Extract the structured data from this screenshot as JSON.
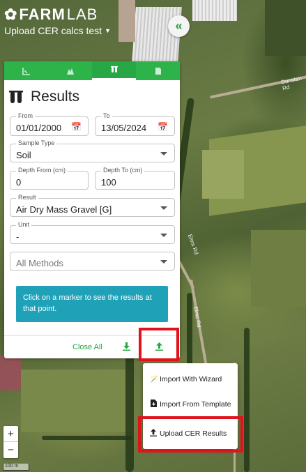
{
  "app": {
    "logo_bold": "FARM",
    "logo_thin": "LAB",
    "project_name": "Upload CER calcs test",
    "collapse_icon": "double-chevron-left-icon"
  },
  "tabs": [
    {
      "name": "chart-tab",
      "icon": "ruler-icon",
      "active": false
    },
    {
      "name": "map-tab",
      "icon": "map-pin-icon",
      "active": false
    },
    {
      "name": "results-tab",
      "icon": "test-tubes-icon",
      "active": true
    },
    {
      "name": "document-tab",
      "icon": "document-icon",
      "active": false
    }
  ],
  "panel": {
    "title": "Results",
    "from_label": "From",
    "from_value": "01/01/2000",
    "to_label": "To",
    "to_value": "13/05/2024",
    "sample_type_label": "Sample Type",
    "sample_type_value": "Soil",
    "depth_from_label": "Depth From (cm)",
    "depth_from_value": "0",
    "depth_to_label": "Depth To (cm)",
    "depth_to_value": "100",
    "result_label": "Result",
    "result_value": "Air Dry Mass Gravel [G]",
    "unit_label": "Unit",
    "unit_value": "-",
    "methods_placeholder": "All Methods",
    "info_text": "Click on a marker to see the results at that point.",
    "close_all": "Close All"
  },
  "menu": {
    "items": [
      {
        "label": "Import With Wizard",
        "icon": "magic-wand-icon"
      },
      {
        "label": "Import From Template",
        "icon": "file-import-icon"
      },
      {
        "label": "Upload CER Results",
        "icon": "upload-icon"
      }
    ]
  },
  "map": {
    "road_labels": [
      "Dunstan Rd",
      "Elms Rd",
      "Elms Rd"
    ],
    "scale_label": "100 m"
  },
  "colors": {
    "accent_green": "#28a745",
    "info_blue": "#1fa2b8",
    "highlight_red": "#e0121b"
  }
}
